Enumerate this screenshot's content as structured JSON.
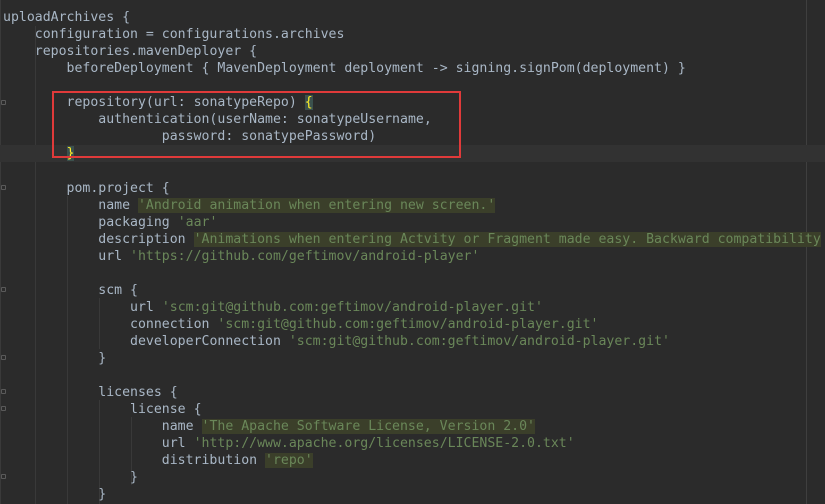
{
  "editor": {
    "lines": [
      {
        "indent": "",
        "tokens": [
          {
            "t": "uploadArchives {",
            "c": "plain"
          }
        ]
      },
      {
        "indent": "    ",
        "tokens": [
          {
            "t": "configuration = configurations.",
            "c": "plain"
          },
          {
            "t": "archives",
            "c": "plain"
          }
        ]
      },
      {
        "indent": "    ",
        "tokens": [
          {
            "t": "repositories.",
            "c": "plain"
          },
          {
            "t": "mavenDeployer",
            "c": "plain"
          },
          {
            "t": " {",
            "c": "plain"
          }
        ]
      },
      {
        "indent": "        ",
        "tokens": [
          {
            "t": "beforeDeployment { MavenDeployment deployment -> signing.signPom(deployment) }",
            "c": "plain"
          }
        ]
      },
      {
        "indent": "",
        "tokens": []
      },
      {
        "indent": "        ",
        "tokens": [
          {
            "t": "repository(",
            "c": "plain"
          },
          {
            "t": "url",
            "c": "plain"
          },
          {
            "t": ": sonatypeRepo) ",
            "c": "plain"
          },
          {
            "t": "{",
            "c": "brace"
          }
        ]
      },
      {
        "indent": "            ",
        "tokens": [
          {
            "t": "authentication(",
            "c": "plain"
          },
          {
            "t": "userName",
            "c": "plain"
          },
          {
            "t": ": sonatypeUsername,",
            "c": "plain"
          }
        ]
      },
      {
        "indent": "                    ",
        "tokens": [
          {
            "t": "password",
            "c": "plain"
          },
          {
            "t": ": sonatypePassword)",
            "c": "plain"
          }
        ]
      },
      {
        "indent": "        ",
        "tokens": [
          {
            "t": "}",
            "c": "brace"
          }
        ]
      },
      {
        "indent": "",
        "tokens": []
      },
      {
        "indent": "        ",
        "tokens": [
          {
            "t": "pom.project {",
            "c": "plain"
          }
        ]
      },
      {
        "indent": "            ",
        "tokens": [
          {
            "t": "name ",
            "c": "plain"
          },
          {
            "t": "'Android animation when entering new screen.'",
            "c": "hl-str"
          }
        ]
      },
      {
        "indent": "            ",
        "tokens": [
          {
            "t": "packaging ",
            "c": "plain"
          },
          {
            "t": "'aar'",
            "c": "str"
          }
        ]
      },
      {
        "indent": "            ",
        "tokens": [
          {
            "t": "description ",
            "c": "plain"
          },
          {
            "t": "'Animations when entering Actvity or Fragment made easy. Backward compatibility",
            "c": "hl-str"
          }
        ]
      },
      {
        "indent": "            ",
        "tokens": [
          {
            "t": "url ",
            "c": "plain"
          },
          {
            "t": "'https://github.com/geftimov/android-player'",
            "c": "str"
          }
        ]
      },
      {
        "indent": "",
        "tokens": []
      },
      {
        "indent": "            ",
        "tokens": [
          {
            "t": "scm {",
            "c": "plain"
          }
        ]
      },
      {
        "indent": "                ",
        "tokens": [
          {
            "t": "url ",
            "c": "plain"
          },
          {
            "t": "'scm:git@github.com:geftimov/android-player.git'",
            "c": "str"
          }
        ]
      },
      {
        "indent": "                ",
        "tokens": [
          {
            "t": "connection ",
            "c": "plain"
          },
          {
            "t": "'scm:git@github.com:geftimov/android-player.git'",
            "c": "str"
          }
        ]
      },
      {
        "indent": "                ",
        "tokens": [
          {
            "t": "developerConnection ",
            "c": "plain"
          },
          {
            "t": "'scm:git@github.com:geftimov/android-player.git'",
            "c": "str"
          }
        ]
      },
      {
        "indent": "            ",
        "tokens": [
          {
            "t": "}",
            "c": "plain"
          }
        ]
      },
      {
        "indent": "",
        "tokens": []
      },
      {
        "indent": "            ",
        "tokens": [
          {
            "t": "licenses {",
            "c": "plain"
          }
        ]
      },
      {
        "indent": "                ",
        "tokens": [
          {
            "t": "license {",
            "c": "plain"
          }
        ]
      },
      {
        "indent": "                    ",
        "tokens": [
          {
            "t": "name ",
            "c": "plain"
          },
          {
            "t": "'The Apache Software License, Version 2.0'",
            "c": "hl-str"
          }
        ]
      },
      {
        "indent": "                    ",
        "tokens": [
          {
            "t": "url ",
            "c": "plain"
          },
          {
            "t": "'http://www.apache.org/licenses/LICENSE-2.0.txt'",
            "c": "str"
          }
        ]
      },
      {
        "indent": "                    ",
        "tokens": [
          {
            "t": "distribution ",
            "c": "plain"
          },
          {
            "t": "'repo'",
            "c": "hl-str"
          }
        ]
      },
      {
        "indent": "                ",
        "tokens": [
          {
            "t": "}",
            "c": "plain"
          }
        ]
      },
      {
        "indent": "            ",
        "tokens": [
          {
            "t": "}",
            "c": "plain"
          }
        ]
      }
    ],
    "caret_line_index": 8
  },
  "annotation": {
    "color": "#e03a3a",
    "label": "highlight-box"
  },
  "colors": {
    "background": "#2b2b2b",
    "text": "#a9b7c6",
    "string": "#6a8759",
    "string_highlight_bg": "#3b3f2a",
    "brace_match": "#ffef28"
  }
}
